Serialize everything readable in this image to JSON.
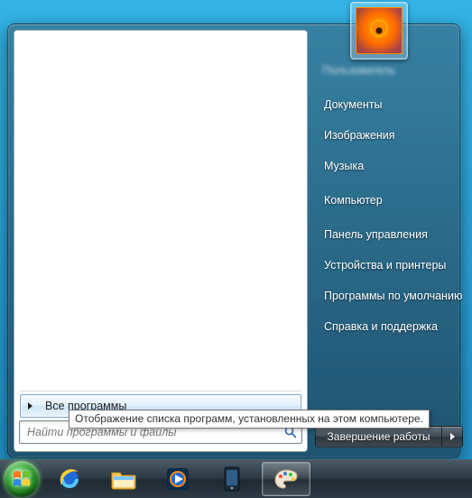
{
  "user": {
    "name": "Пользователь"
  },
  "left": {
    "all_programs_label": "Все программы",
    "search_placeholder": "Найти программы и файлы",
    "tooltip": "Отображение списка программ, установленных на этом компьютере."
  },
  "right": {
    "items": [
      "Документы",
      "Изображения",
      "Музыка",
      "Компьютер",
      "Панель управления",
      "Устройства и принтеры",
      "Программы по умолчанию",
      "Справка и поддержка"
    ],
    "shutdown_label": "Завершение работы"
  },
  "taskbar": {
    "items": [
      "internet-explorer",
      "windows-explorer",
      "windows-media-player",
      "phone",
      "paint"
    ],
    "active_index": 4
  }
}
